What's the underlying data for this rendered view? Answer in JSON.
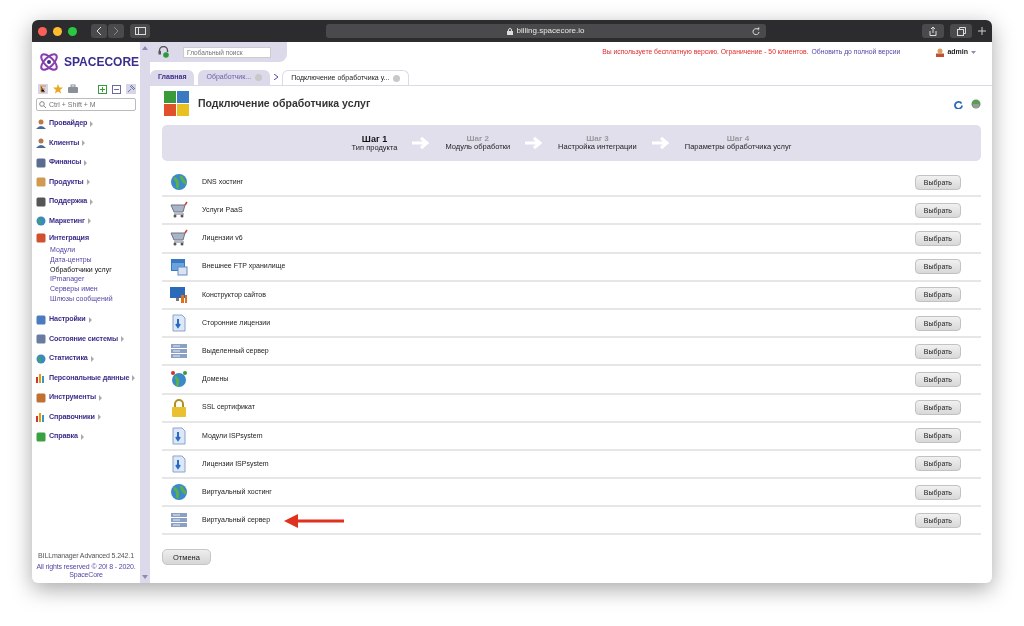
{
  "browser": {
    "address": "billing.spacecore.io"
  },
  "logo": {
    "text": "SPACECORE"
  },
  "sidebar": {
    "search": {
      "placeholder": "Ctrl + Shift + M"
    },
    "items": [
      {
        "label": "Провайдер",
        "expanded": false
      },
      {
        "label": "Клиенты",
        "expanded": false
      },
      {
        "label": "Финансы",
        "expanded": false
      },
      {
        "label": "Продукты",
        "expanded": false
      },
      {
        "label": "Поддержка",
        "expanded": false
      },
      {
        "label": "Маркетинг",
        "expanded": false
      },
      {
        "label": "Интеграция",
        "expanded": true,
        "children": [
          {
            "label": "Модули",
            "selected": false
          },
          {
            "label": "Дата-центры",
            "selected": false
          },
          {
            "label": "Обработчики услуг",
            "selected": true
          },
          {
            "label": "IPmanager",
            "selected": false
          },
          {
            "label": "Серверы имен",
            "selected": false
          },
          {
            "label": "Шлюзы сообщений",
            "selected": false
          }
        ]
      },
      {
        "label": "Настройки",
        "expanded": false
      },
      {
        "label": "Состояние системы",
        "expanded": false
      },
      {
        "label": "Статистика",
        "expanded": false
      },
      {
        "label": "Персональные данные",
        "expanded": false
      },
      {
        "label": "Инструменты",
        "expanded": false
      },
      {
        "label": "Справочники",
        "expanded": false
      },
      {
        "label": "Справка",
        "expanded": false
      }
    ],
    "footer": {
      "version": "BILLmanager Advanced 5.242.1",
      "copyright": "All rights reserved © 20! 8 - 2020.",
      "company": "SpaceCore"
    }
  },
  "topbar": {
    "search": {
      "placeholder": "Глобальный поиск"
    },
    "notice": "Вы используете бесплатную версию. Ограничение - 50 клиентов.",
    "upgrade_link": "Обновить до полной версии",
    "user": "admin"
  },
  "tabs": [
    {
      "label": "Главная",
      "selected": false,
      "closable": false
    },
    {
      "label": "Обработчик...",
      "selected": false,
      "closable": true
    },
    {
      "label": "Подключение обработчика у...",
      "selected": true,
      "closable": true
    }
  ],
  "page": {
    "title": "Подключение обработчика услуг",
    "steps": [
      {
        "step": "Шаг 1",
        "label": "Тип продукта",
        "selected": true
      },
      {
        "step": "Шаг 2",
        "label": "Модуль обработки",
        "selected": false
      },
      {
        "step": "Шаг 3",
        "label": "Настройка интеграции",
        "selected": false
      },
      {
        "step": "Шаг 4",
        "label": "Параметры обработчика услуг",
        "selected": false
      }
    ],
    "rows": [
      {
        "name": "DNS хостинг",
        "button": "Выбрать",
        "annotated": false
      },
      {
        "name": "Услуги PaaS",
        "button": "Выбрать",
        "annotated": false
      },
      {
        "name": "Лицензии v6",
        "button": "Выбрать",
        "annotated": false
      },
      {
        "name": "Внешнее FTP хранилище",
        "button": "Выбрать",
        "annotated": false
      },
      {
        "name": "Конструктор сайтов",
        "button": "Выбрать",
        "annotated": false
      },
      {
        "name": "Сторонние лицензии",
        "button": "Выбрать",
        "annotated": false
      },
      {
        "name": "Выделенный сервер",
        "button": "Выбрать",
        "annotated": false
      },
      {
        "name": "Домены",
        "button": "Выбрать",
        "annotated": false
      },
      {
        "name": "SSL сертификат",
        "button": "Выбрать",
        "annotated": false
      },
      {
        "name": "Модули ISPsystem",
        "button": "Выбрать",
        "annotated": false
      },
      {
        "name": "Лицензии ISPsystem",
        "button": "Выбрать",
        "annotated": false
      },
      {
        "name": "Виртуальный хостинг",
        "button": "Выбрать",
        "annotated": false
      },
      {
        "name": "Виртуальный сервер",
        "button": "Выбрать",
        "annotated": true
      }
    ],
    "cancel": "Отмена"
  }
}
